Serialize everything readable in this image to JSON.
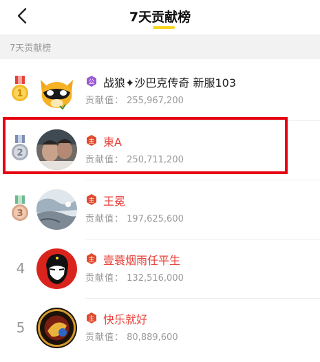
{
  "header": {
    "title": "7天贡献榜"
  },
  "section": {
    "label": "7天贡献榜"
  },
  "contrib_label": "贡献值：",
  "rows": [
    {
      "rank": "1",
      "name": "战狼✦沙巴克传奇 新服103",
      "contribution": "255,967,200",
      "badge": "公",
      "name_color": "black"
    },
    {
      "rank": "2",
      "name": "東A",
      "contribution": "250,711,200",
      "badge": "主",
      "name_color": "red"
    },
    {
      "rank": "3",
      "name": "王冕",
      "contribution": "197,625,600",
      "badge": "主",
      "name_color": "red"
    },
    {
      "rank": "4",
      "name": "壹蓑烟雨任平生",
      "contribution": "132,516,000",
      "badge": "主",
      "name_color": "red"
    },
    {
      "rank": "5",
      "name": "快乐就好",
      "contribution": "80,889,600",
      "badge": "主",
      "name_color": "red"
    }
  ],
  "colors": {
    "accent_yellow": "#f7d61e",
    "name_red": "#e8413a",
    "highlight_red": "#e60012",
    "gray_text": "#999999"
  }
}
